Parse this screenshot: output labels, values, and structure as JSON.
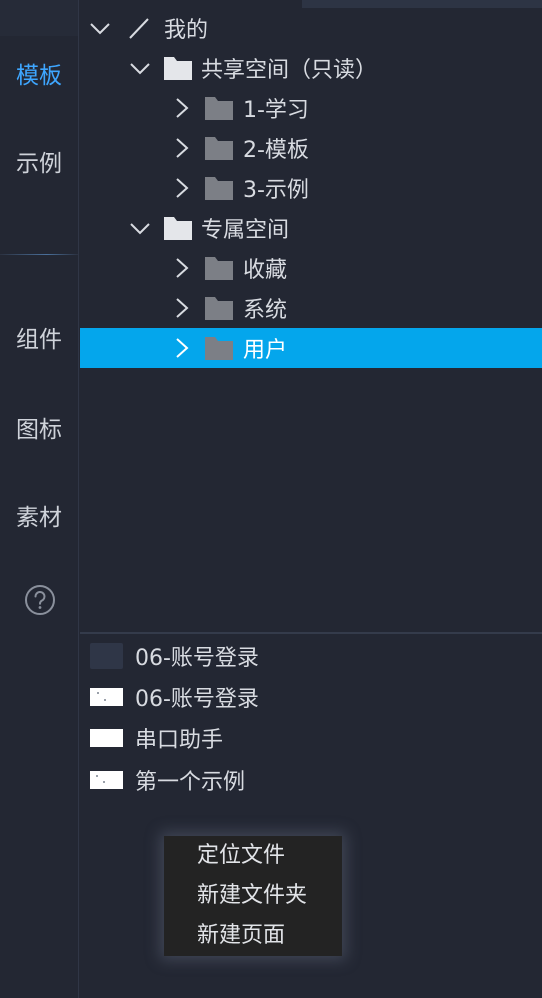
{
  "rail": {
    "items": [
      {
        "label": "模板",
        "active": true
      },
      {
        "label": "示例",
        "active": false
      },
      {
        "label": "组件",
        "active": false
      },
      {
        "label": "图标",
        "active": false
      },
      {
        "label": "素材",
        "active": false
      }
    ],
    "help_icon": "question-circle-icon",
    "accent": "#3ea6ff"
  },
  "tree": {
    "root": {
      "label": "我的",
      "expanded": true
    },
    "shared": {
      "label": "共享空间（只读）",
      "expanded": true
    },
    "shared_children": [
      {
        "label": "1-学习"
      },
      {
        "label": "2-模板"
      },
      {
        "label": "3-示例"
      }
    ],
    "exclusive": {
      "label": "专属空间",
      "expanded": true
    },
    "exclusive_children": [
      {
        "label": "收藏"
      },
      {
        "label": "系统"
      },
      {
        "label": "用户",
        "selected": true
      }
    ],
    "selection_color": "#04a6ec"
  },
  "files": [
    {
      "label": "06-账号登录",
      "thumb": "dark"
    },
    {
      "label": "06-账号登录",
      "thumb": "light"
    },
    {
      "label": "串口助手",
      "thumb": "light"
    },
    {
      "label": "第一个示例",
      "thumb": "light"
    }
  ],
  "context_menu": {
    "items": [
      {
        "label": "定位文件"
      },
      {
        "label": "新建文件夹"
      },
      {
        "label": "新建页面"
      }
    ]
  }
}
